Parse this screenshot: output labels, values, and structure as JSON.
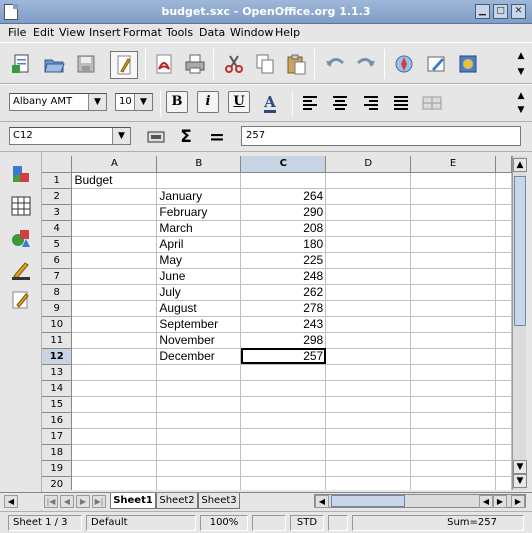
{
  "window": {
    "title": "budget.sxc - OpenOffice.org 1.1.3"
  },
  "menu": [
    "File",
    "Edit",
    "View",
    "Insert",
    "Format",
    "Tools",
    "Data",
    "Window",
    "Help"
  ],
  "format": {
    "font_name": "Albany AMT",
    "font_size": "10",
    "bold": "B",
    "italic": "i",
    "underline": "U",
    "font_color": "A"
  },
  "formula": {
    "cell_ref": "C12",
    "sum_symbol": "Σ",
    "equals_symbol": "=",
    "content": "257"
  },
  "grid": {
    "columns": [
      "A",
      "B",
      "C",
      "D",
      "E"
    ],
    "selected_column": "C",
    "selected_row": "12",
    "rows": [
      {
        "n": "1",
        "a": "Budget",
        "b": "",
        "c": ""
      },
      {
        "n": "2",
        "a": "",
        "b": "January",
        "c": "264"
      },
      {
        "n": "3",
        "a": "",
        "b": "February",
        "c": "290"
      },
      {
        "n": "4",
        "a": "",
        "b": "March",
        "c": "208"
      },
      {
        "n": "5",
        "a": "",
        "b": "April",
        "c": "180"
      },
      {
        "n": "6",
        "a": "",
        "b": "May",
        "c": "225"
      },
      {
        "n": "7",
        "a": "",
        "b": "June",
        "c": "248"
      },
      {
        "n": "8",
        "a": "",
        "b": "July",
        "c": "262"
      },
      {
        "n": "9",
        "a": "",
        "b": "August",
        "c": "278"
      },
      {
        "n": "10",
        "a": "",
        "b": "September",
        "c": "243"
      },
      {
        "n": "11",
        "a": "",
        "b": "November",
        "c": "298"
      },
      {
        "n": "12",
        "a": "",
        "b": "December",
        "c": "257"
      },
      {
        "n": "13",
        "a": "",
        "b": "",
        "c": ""
      },
      {
        "n": "14",
        "a": "",
        "b": "",
        "c": ""
      },
      {
        "n": "15",
        "a": "",
        "b": "",
        "c": ""
      },
      {
        "n": "16",
        "a": "",
        "b": "",
        "c": ""
      },
      {
        "n": "17",
        "a": "",
        "b": "",
        "c": ""
      },
      {
        "n": "18",
        "a": "",
        "b": "",
        "c": ""
      },
      {
        "n": "19",
        "a": "",
        "b": "",
        "c": ""
      },
      {
        "n": "20",
        "a": "",
        "b": "",
        "c": ""
      }
    ]
  },
  "sheets": [
    "Sheet1",
    "Sheet2",
    "Sheet3"
  ],
  "active_sheet": "Sheet1",
  "status": {
    "page": "Sheet 1 / 3",
    "style": "Default",
    "zoom": "100%",
    "mode": "STD",
    "sum": "Sum=257"
  },
  "colors": {
    "titlebar": "#8aa6cc",
    "selection_header": "#c6d4e4",
    "background": "#e6e6e6"
  },
  "icons": {
    "main_toolbar": [
      "new-document-icon",
      "open-folder-icon",
      "save-icon",
      "edit-file-icon",
      "export-pdf-icon",
      "print-icon",
      "cut-icon",
      "copy-icon",
      "paste-icon",
      "undo-icon",
      "redo-icon",
      "navigator-icon",
      "gallery-icon",
      "data-sources-icon"
    ],
    "side_toolbar": [
      "insert-icon",
      "insert-cell-icon",
      "insert-object-icon",
      "show-draw-functions-icon",
      "edit-icon"
    ]
  }
}
